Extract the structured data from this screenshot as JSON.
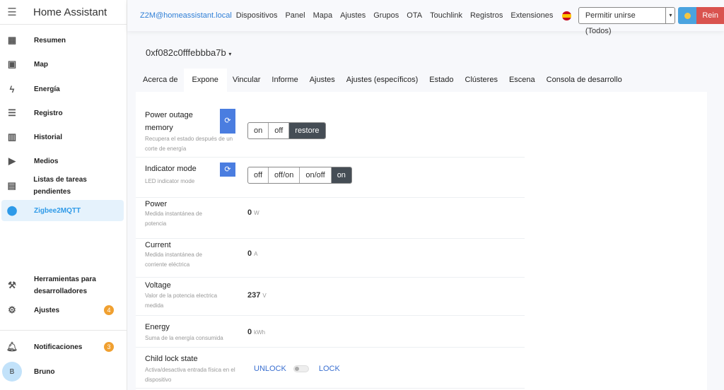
{
  "sidebar": {
    "title": "Home Assistant",
    "items": [
      {
        "label": "Resumen",
        "icon": "view-dashboard-icon"
      },
      {
        "label": "Map",
        "icon": "map-account-icon"
      },
      {
        "label": "Energía",
        "icon": "lightning-icon"
      },
      {
        "label": "Registro",
        "icon": "list-icon"
      },
      {
        "label": "Historial",
        "icon": "chart-box-icon"
      },
      {
        "label": "Medios",
        "icon": "play-box-icon"
      },
      {
        "label": "Listas de tareas pendientes",
        "icon": "clipboard-list-icon"
      },
      {
        "label": "Zigbee2MQTT",
        "icon": "zigbee-icon",
        "active": true
      }
    ],
    "dev_tools": "Herramientas para desarrolladores",
    "settings": "Ajustes",
    "settings_badge": "4",
    "notifications": "Notificaciones",
    "notifications_badge": "3",
    "user": "Bruno",
    "user_initial": "B"
  },
  "topnav": {
    "brand": "Z2M@homeassistant.local",
    "links": [
      "Dispositivos",
      "Panel",
      "Mapa",
      "Ajustes",
      "Grupos",
      "OTA",
      "Touchlink",
      "Registros",
      "Extensiones"
    ],
    "permit_join": "Permitir unirse (Todos)",
    "restart": "Rein"
  },
  "device": {
    "title": "0xf082c0fffebbba7b"
  },
  "tabs": [
    "Acerca de",
    "Expone",
    "Vincular",
    "Informe",
    "Ajustes",
    "Ajustes (específicos)",
    "Estado",
    "Clústeres",
    "Escena",
    "Consola de desarrollo"
  ],
  "active_tab": "Expone",
  "exposes": {
    "power_outage": {
      "name": "Power outage memory",
      "desc": "Recupera el estado después de un corte de energía",
      "options": [
        "on",
        "off",
        "restore"
      ],
      "selected": "restore"
    },
    "indicator": {
      "name": "Indicator mode",
      "desc": "LED indicator mode",
      "options": [
        "off",
        "off/on",
        "on/off",
        "on"
      ],
      "selected": "on"
    },
    "power": {
      "name": "Power",
      "desc": "Medida instantánea de potencia",
      "value": "0",
      "unit": "W"
    },
    "current": {
      "name": "Current",
      "desc": "Medida instantánea de corriente eléctrica",
      "value": "0",
      "unit": "A"
    },
    "voltage": {
      "name": "Voltage",
      "desc": "Valor de la potencia electrica medida",
      "value": "237",
      "unit": "V"
    },
    "energy": {
      "name": "Energy",
      "desc": "Suma de la energía consumida",
      "value": "0",
      "unit": "kWh"
    },
    "child_lock": {
      "name": "Child lock state",
      "desc": "Activa/desactiva entrada física en el dispositivo",
      "off_label": "UNLOCK",
      "on_label": "LOCK",
      "state": "UNLOCK"
    }
  },
  "colors": {
    "accent": "#2e9ae8",
    "refresh": "#4a7de0",
    "selected": "#454d55",
    "badge": "#f0a030",
    "restart": "#d9534f"
  }
}
